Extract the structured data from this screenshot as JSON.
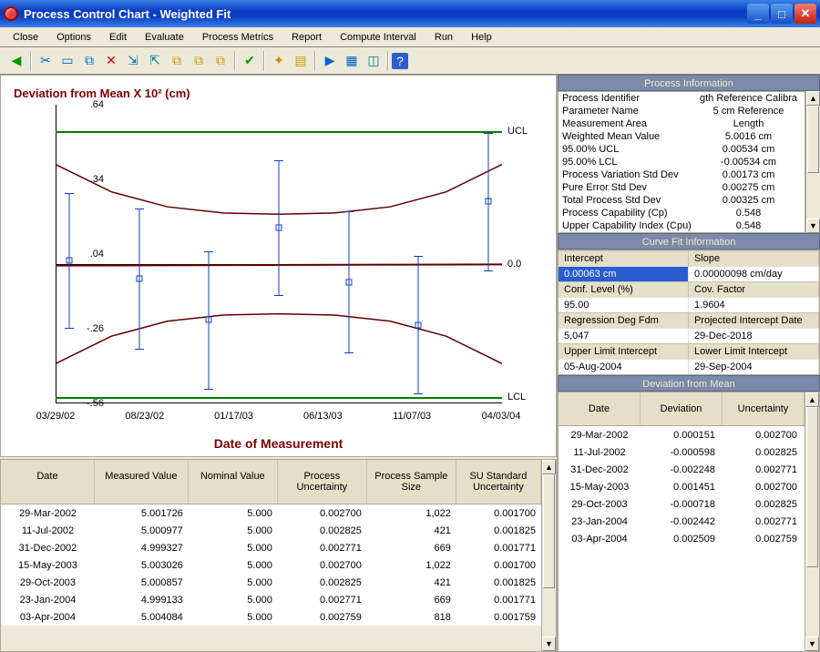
{
  "window": {
    "title": "Process Control Chart - Weighted Fit"
  },
  "menu": [
    "Close",
    "Options",
    "Edit",
    "Evaluate",
    "Process Metrics",
    "Report",
    "Compute Interval",
    "Run",
    "Help"
  ],
  "toolbar_icons": [
    "back",
    "cut",
    "copy",
    "paste",
    "delete",
    "tree-expand",
    "tree-collapse",
    "dup1",
    "dup2",
    "dup3",
    "check",
    "wand",
    "note",
    "space",
    "play",
    "grid",
    "toggle",
    "help"
  ],
  "chart_data": {
    "type": "scatter-errbar",
    "title": "Deviation from Mean X 10²  (cm)",
    "xlabel": "Date of Measurement",
    "ylim": [
      -0.56,
      0.64
    ],
    "yticks": [
      -0.56,
      -0.26,
      0.04,
      0.34,
      0.64
    ],
    "ucl": 0.534,
    "lcl": -0.534,
    "zero": 0.0,
    "xlabels": [
      "03/29/02",
      "08/23/02",
      "01/17/03",
      "06/13/03",
      "11/07/03",
      "04/03/04"
    ],
    "right_labels": {
      "ucl": "UCL",
      "zero": "0.0",
      "lcl": "LCL"
    },
    "series": [
      {
        "name": "deviation",
        "points": [
          {
            "date": "29-Mar-2002",
            "xi": 0,
            "y": 0.000151,
            "u": 0.0027
          },
          {
            "date": "11-Jul-2002",
            "xi": 1,
            "y": -0.000598,
            "u": 0.002825
          },
          {
            "date": "31-Dec-2002",
            "xi": 2,
            "y": -0.002248,
            "u": 0.002771
          },
          {
            "date": "15-May-2003",
            "xi": 3,
            "y": 0.001451,
            "u": 0.0027
          },
          {
            "date": "29-Oct-2003",
            "xi": 4,
            "y": -0.000718,
            "u": 0.002825
          },
          {
            "date": "23-Jan-2004",
            "xi": 5,
            "y": -0.002442,
            "u": 0.002771
          },
          {
            "date": "03-Apr-2004",
            "xi": 6,
            "y": 0.002509,
            "u": 0.002759
          }
        ]
      }
    ],
    "fit": {
      "intercept": -0.00063,
      "slope": 9.8e-07,
      "unit": "cm/day"
    },
    "conf_upper": [
      0.4,
      0.29,
      0.23,
      0.205,
      0.2,
      0.205,
      0.23,
      0.29,
      0.4
    ],
    "conf_lower": [
      -0.4,
      -0.29,
      -0.23,
      -0.205,
      -0.2,
      -0.205,
      -0.23,
      -0.29,
      -0.4
    ]
  },
  "process_info": {
    "title": "Process Information",
    "rows": [
      {
        "k": "Process Identifier",
        "v": "gth Reference Calibra"
      },
      {
        "k": "Parameter Name",
        "v": "5 cm Reference"
      },
      {
        "k": "Measurement Area",
        "v": "Length"
      },
      {
        "k": "Weighted Mean Value",
        "v": "5.0016 cm"
      },
      {
        "k": "95.00% UCL",
        "v": "0.00534 cm"
      },
      {
        "k": "95.00% LCL",
        "v": "-0.00534 cm"
      },
      {
        "k": "Process Variation Std Dev",
        "v": "0.00173 cm"
      },
      {
        "k": "Pure Error Std Dev",
        "v": "0.00275 cm"
      },
      {
        "k": "Total Process Std Dev",
        "v": "0.00325 cm"
      },
      {
        "k": "Process Capability (Cp)",
        "v": "0.548"
      },
      {
        "k": "Upper Capability Index (Cpu)",
        "v": "0.548"
      }
    ]
  },
  "curve_fit": {
    "title": "Curve Fit  Information",
    "rows": [
      [
        "Intercept",
        "Slope"
      ],
      [
        "0.00063 cm",
        "0.00000098 cm/day"
      ],
      [
        "Conf. Level (%)",
        "Cov. Factor"
      ],
      [
        "95.00",
        "1.9604"
      ],
      [
        "Regression Deg Fdm",
        "Projected Intercept Date"
      ],
      [
        "5,047",
        "29-Dec-2018"
      ],
      [
        "Upper Limit Intercept",
        "Lower Limit Intercept"
      ],
      [
        "05-Aug-2004",
        "29-Sep-2004"
      ]
    ]
  },
  "deviation_panel": {
    "title": "Deviation from Mean",
    "headers": [
      "Date",
      "Deviation",
      "Uncertainty"
    ],
    "rows": [
      [
        "29-Mar-2002",
        "0.000151",
        "0.002700"
      ],
      [
        "11-Jul-2002",
        "-0.000598",
        "0.002825"
      ],
      [
        "31-Dec-2002",
        "-0.002248",
        "0.002771"
      ],
      [
        "15-May-2003",
        "0.001451",
        "0.002700"
      ],
      [
        "29-Oct-2003",
        "-0.000718",
        "0.002825"
      ],
      [
        "23-Jan-2004",
        "-0.002442",
        "0.002771"
      ],
      [
        "03-Apr-2004",
        "0.002509",
        "0.002759"
      ]
    ]
  },
  "data_table": {
    "headers": [
      "Date",
      "Measured Value",
      "Nominal Value",
      "Process Uncertainty",
      "Process Sample Size",
      "SU Standard Uncertainty"
    ],
    "rows": [
      [
        "29-Mar-2002",
        "5.001726",
        "5.000",
        "0.002700",
        "1,022",
        "0.001700"
      ],
      [
        "11-Jul-2002",
        "5.000977",
        "5.000",
        "0.002825",
        "421",
        "0.001825"
      ],
      [
        "31-Dec-2002",
        "4.999327",
        "5.000",
        "0.002771",
        "669",
        "0.001771"
      ],
      [
        "15-May-2003",
        "5.003026",
        "5.000",
        "0.002700",
        "1,022",
        "0.001700"
      ],
      [
        "29-Oct-2003",
        "5.000857",
        "5.000",
        "0.002825",
        "421",
        "0.001825"
      ],
      [
        "23-Jan-2004",
        "4.999133",
        "5.000",
        "0.002771",
        "669",
        "0.001771"
      ],
      [
        "03-Apr-2004",
        "5.004084",
        "5.000",
        "0.002759",
        "818",
        "0.001759"
      ]
    ]
  }
}
